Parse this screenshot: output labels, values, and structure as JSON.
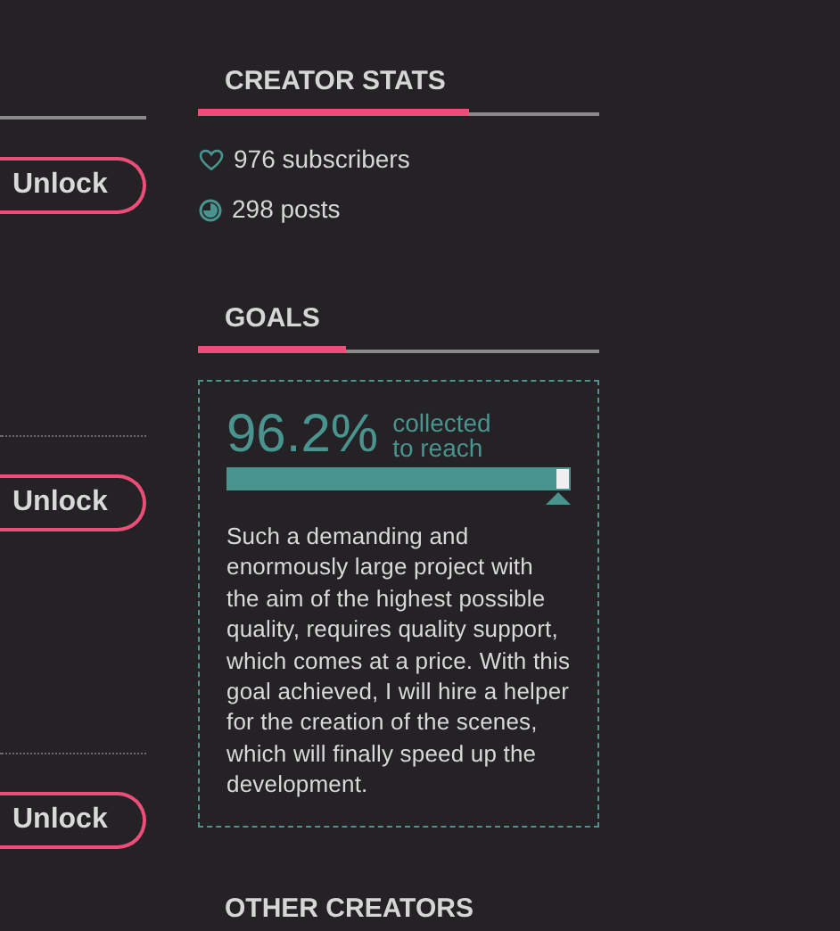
{
  "posts": [
    {
      "unlock_button": "Unlock",
      "kind": "solid"
    },
    {
      "unlock_button": "Unlock",
      "kind": "dotted"
    },
    {
      "unlock_button": "Unlock",
      "kind": "dotted"
    }
  ],
  "creator_stats": {
    "title": "CREATOR STATS",
    "items": [
      {
        "kind": "heart",
        "text": "976 subscribers"
      },
      {
        "kind": "posts",
        "text": "298 posts"
      }
    ]
  },
  "goals": {
    "title": "GOALS",
    "percent": "96.2%",
    "caption_1": "collected",
    "caption_2": "to reach",
    "level": 0.962,
    "description": "Such a demanding and enormously large project with the aim of the highest possible quality, requires quality support, which comes at a price. With this goal achieved, I will hire a helper for the creation of the scenes, which will finally speed up the development."
  },
  "other_creators": {
    "title": "OTHER CREATORS"
  }
}
